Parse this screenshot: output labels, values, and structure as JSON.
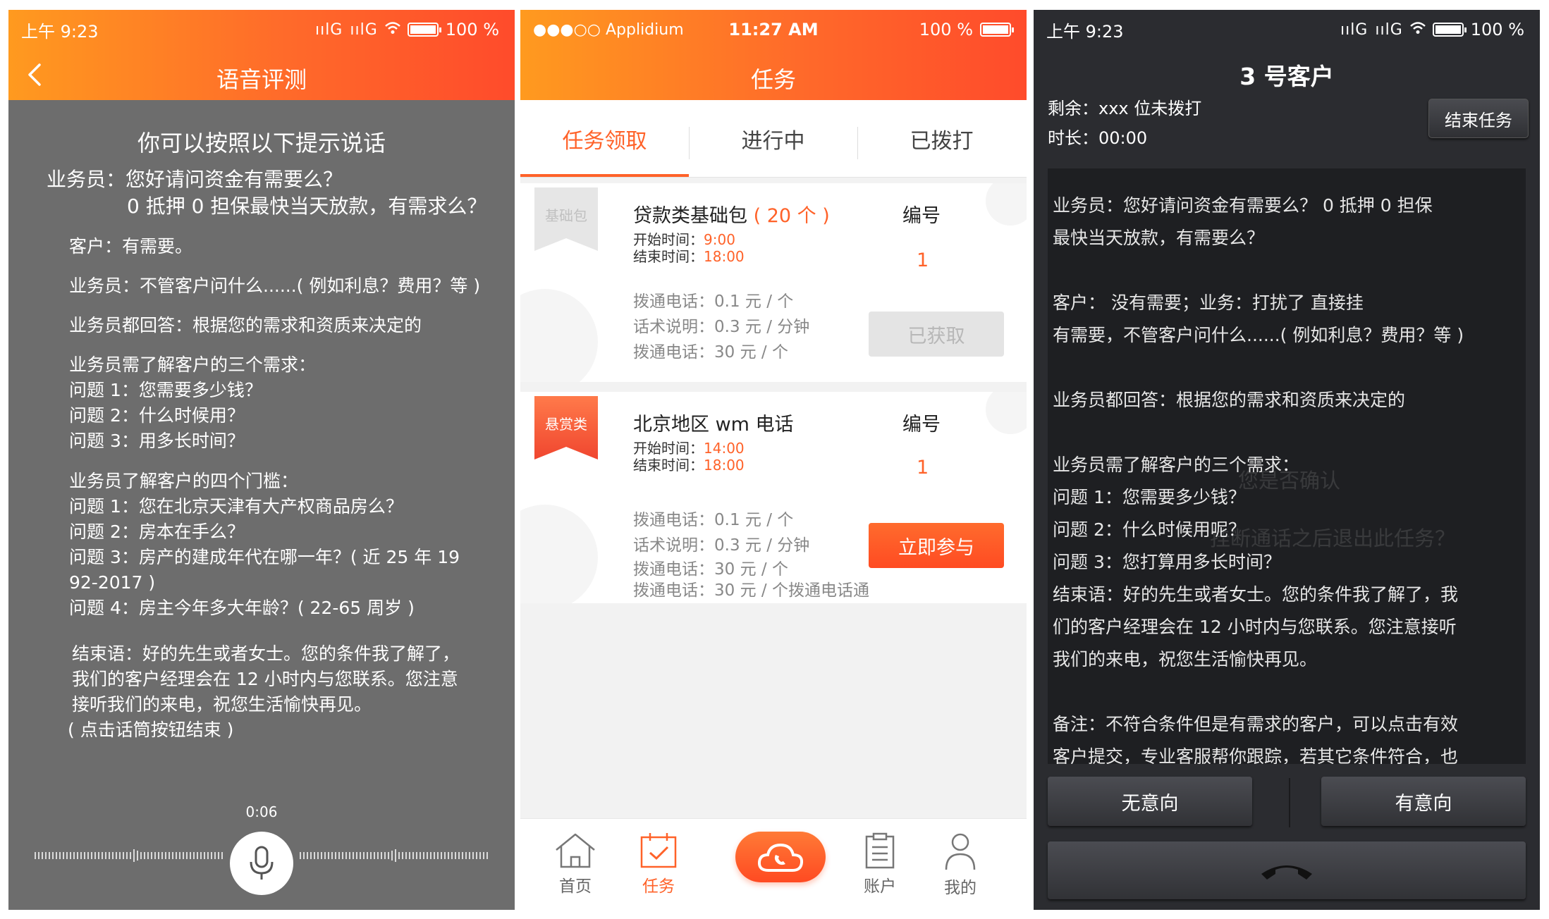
{
  "screen1": {
    "status": {
      "time": "上午 9:23",
      "signal1": "ıılG",
      "signal2": "ıılG",
      "battery": "100 %"
    },
    "title": "语音评测",
    "heading": "你可以按照以下提示说话",
    "intro_line1": "业务员：您好请问资金有需要么？",
    "intro_line2": "0 抵押 0 担保最快当天放款，有需求么？",
    "customer": "客户：有需要。",
    "agent_any": "业务员：不管客户问什么......( 例如利息？费用？等 )",
    "agent_answer": "业务员都回答：根据您的需求和资质来决定的",
    "needs_title": "业务员需了解客户的三个需求：",
    "needs": [
      "问题 1：您需要多少钱？",
      "问题 2：什么时候用？",
      "问题 3：用多长时间？"
    ],
    "thresholds_title": "业务员了解客户的四个门槛：",
    "thresholds": [
      "问题 1：您在北京天津有大产权商品房么？",
      "问题 2：房本在手么？",
      "问题 3：房产的建成年代在哪一年？( 近 25 年 19",
      "92-2017 )",
      "问题 4：房主今年多大年龄？( 22-65 周岁 )"
    ],
    "closing": [
      "结束语：好的先生或者女士。您的条件我了解了，",
      "我们的客户经理会在 12 小时内与您联系。您注意",
      "接听我们的来电，祝您生活愉快再见。",
      "( 点击话筒按钮结束 )"
    ],
    "timer": "0:06"
  },
  "screen2": {
    "status": {
      "carrier": "●●●○○ Applidium",
      "time": "11:27 AM",
      "battery": "100 %"
    },
    "title": "任务",
    "tabs": [
      "任务领取",
      "进行中",
      "已拨打"
    ],
    "card1": {
      "ribbon": "基础包",
      "title": "贷款类基础包",
      "count": "( 20 个 )",
      "start_label": "开始时间：",
      "start": "9:00",
      "end_label": "结束时间：",
      "end": "18:00",
      "num_label": "编号",
      "num": "1",
      "prices": [
        "拨通电话：0.1 元 / 个",
        "话术说明：0.3 元 / 分钟",
        "拨通电话：30 元 / 个"
      ],
      "button": "已获取"
    },
    "card2": {
      "ribbon": "悬赏类",
      "title": "北京地区 wm 电话",
      "start_label": "开始时间：",
      "start": "14:00",
      "end_label": "结束时间：",
      "end": "18:00",
      "num_label": "编号",
      "num": "1",
      "prices": [
        "拨通电话：0.1 元 / 个",
        "话术说明：0.3 元 / 分钟",
        "拨通电话：30 元 / 个",
        "拨通电话：30 元 / 个拨通电话通"
      ],
      "button": "立即参与"
    },
    "tabbar": {
      "home": "首页",
      "task": "任务",
      "account": "账户",
      "mine": "我的"
    }
  },
  "screen3": {
    "status": {
      "time": "上午 9:23",
      "signal1": "ıılG",
      "signal2": "ıılG",
      "battery": "100 %"
    },
    "title": "3 号客户",
    "remaining": "剩余：xxx 位未拨打",
    "duration": "时长：00:00",
    "end_button": "结束任务",
    "script": [
      "业务员：您好请问资金有需要么？ 0 抵押 0 担保",
      "最快当天放款，有需要么？",
      "客户： 没有需要；业务：打扰了 直接挂",
      "有需要，不管客户问什么......( 例如利息？费用？等 )",
      "业务员都回答：根据您的需求和资质来决定的",
      "业务员需了解客户的三个需求：",
      "问题 1：您需要多少钱？",
      "问题 2：什么时候用呢？",
      "问题 3：您打算用多长时间？",
      "结束语：好的先生或者女士。您的条件我了解了，我",
      "们的客户经理会在 12 小时内与您联系。您注意接听",
      "我们的来电，祝您生活愉快再见。",
      "备注：不符合条件但是有需求的客户，可以点击有效",
      "客户提交，专业客服帮你跟踪，若其它条件符合，也"
    ],
    "overlay1": "您是否确认",
    "overlay2": "挂断通话之后退出此任务？",
    "no_intent": "无意向",
    "intent": "有意向"
  }
}
